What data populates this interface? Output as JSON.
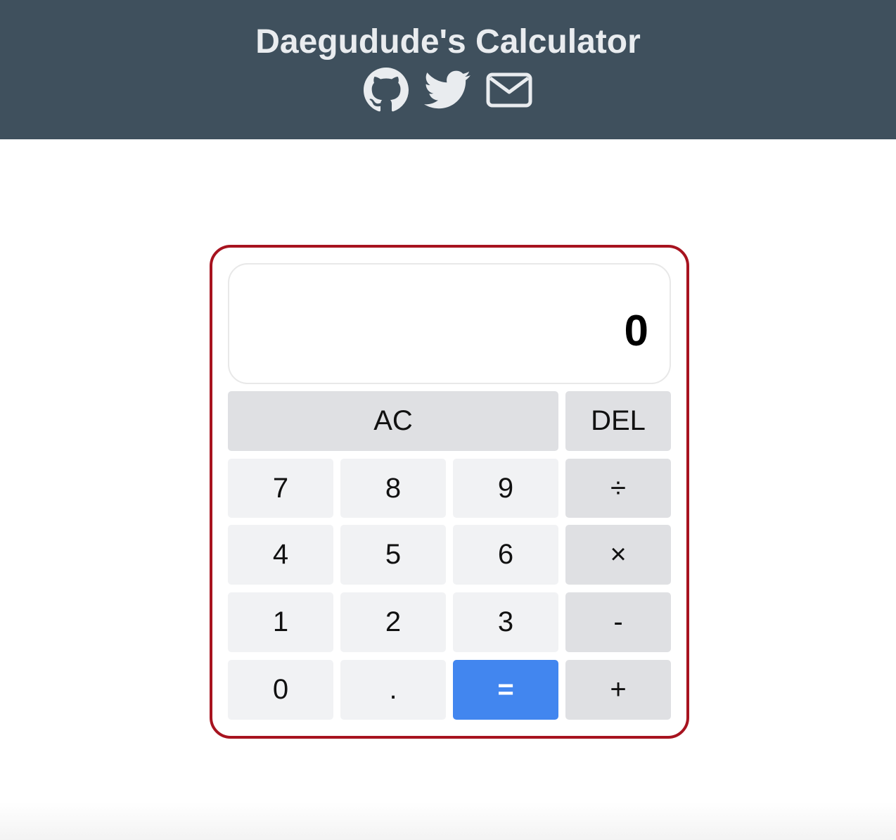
{
  "header": {
    "title": "Daegudude's Calculator",
    "background": "#3f505d",
    "links": [
      {
        "name": "github-icon",
        "icon": "github"
      },
      {
        "name": "twitter-icon",
        "icon": "twitter"
      },
      {
        "name": "mail-icon",
        "icon": "envelope"
      }
    ]
  },
  "calculator": {
    "border_color": "#a7131f",
    "display": "0",
    "buttons": {
      "ac": "AC",
      "del": "DEL",
      "seven": "7",
      "eight": "8",
      "nine": "9",
      "divide": "÷",
      "four": "4",
      "five": "5",
      "six": "6",
      "multiply": "×",
      "one": "1",
      "two": "2",
      "three": "3",
      "minus": "-",
      "zero": "0",
      "dot": ".",
      "equals": "=",
      "plus": "+"
    },
    "colors": {
      "number_key": "#f1f2f4",
      "operator_key": "#dfe0e3",
      "equals_key": "#4286ef"
    }
  }
}
